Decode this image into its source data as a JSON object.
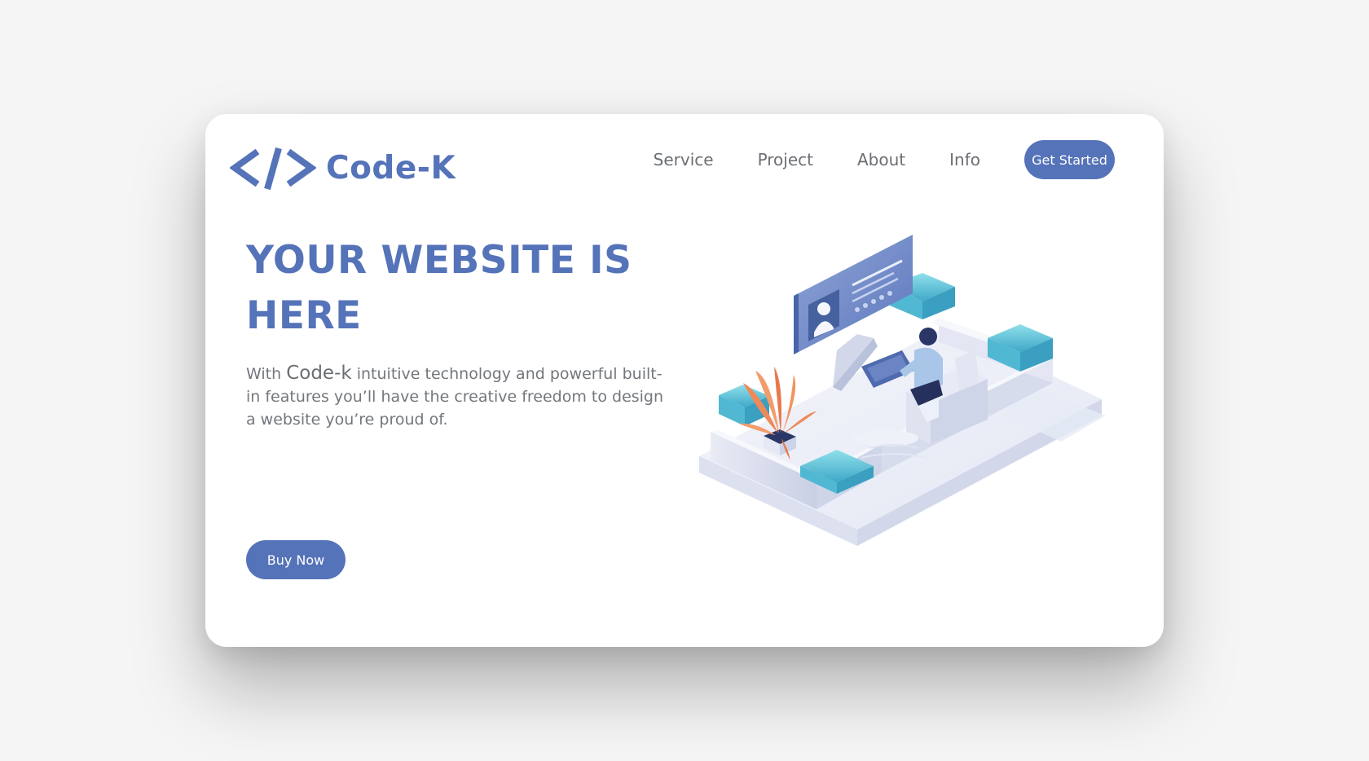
{
  "brand": {
    "name": "Code-K",
    "logo_icon": "code-brackets-icon",
    "accent_color": "#5573b8"
  },
  "nav": {
    "items": [
      {
        "label": "Service"
      },
      {
        "label": "Project"
      },
      {
        "label": "About"
      },
      {
        "label": "Info"
      }
    ],
    "cta_label": "Get Started"
  },
  "hero": {
    "title": "YOUR WEBSITE IS HERE",
    "description_pre": "With ",
    "description_brand": "Code-k",
    "description_post": " intuitive technology and powerful built-in features you’ll have the creative freedom to design a website you’re proud of.",
    "cta_label": "Buy Now"
  },
  "illustration": {
    "icon": "isometric-workspace-illustration"
  }
}
